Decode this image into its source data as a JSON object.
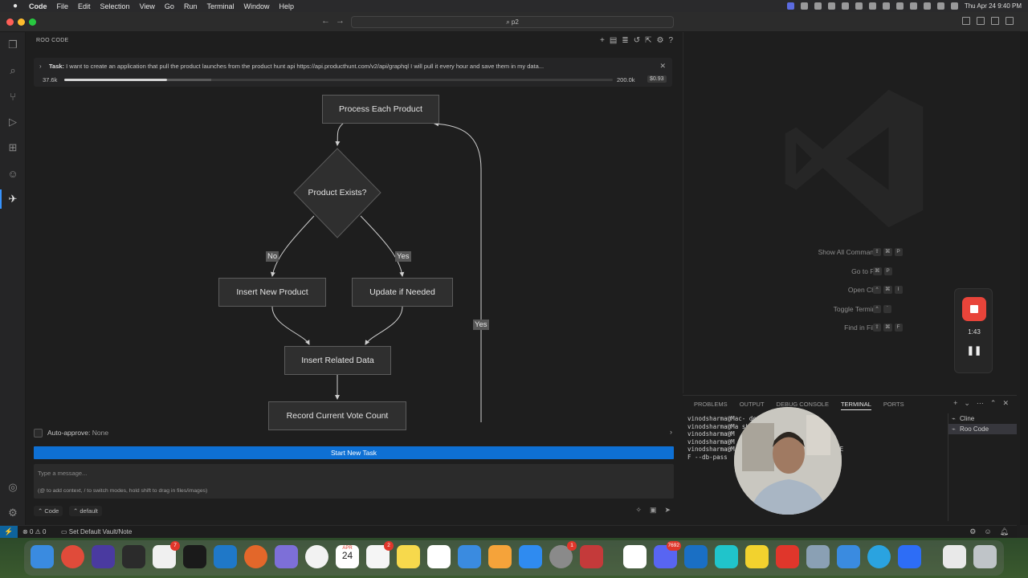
{
  "menubar": {
    "app": "Code",
    "items": [
      "File",
      "Edit",
      "Selection",
      "View",
      "Go",
      "Run",
      "Terminal",
      "Window",
      "Help"
    ],
    "clock": "Thu Apr 24  9:40 PM"
  },
  "titlebar": {
    "search": "p2"
  },
  "roo": {
    "header": "ROO CODE",
    "task_label": "Task:",
    "task_text": "I want to create an application that pull the product launches from the product hunt api https://api.producthunt.com/v2/api/graphql I will pull it every hour and save them in my data...",
    "tokens_used": "37.6k",
    "tokens_max": "200.0k",
    "token_progress": 0.188,
    "cost": "$0.93"
  },
  "flow": {
    "process": "Process Each Product",
    "decision": "Product Exists?",
    "insert_new": "Insert New Product",
    "update": "Update if Needed",
    "insert_related": "Insert Related Data",
    "record_vote": "Record Current Vote Count",
    "label_no": "No",
    "label_yes": "Yes",
    "label_loop_yes": "Yes"
  },
  "composer": {
    "auto_approve_label": "Auto-approve:",
    "auto_approve_value": "None",
    "new_task": "Start New Task",
    "placeholder": "Type a message...",
    "hint": "(@ to add context, / to switch modes, hold shift to drag in files/images)",
    "mode": "Code",
    "profile": "default"
  },
  "editor": {
    "shortcuts": [
      {
        "label": "Show All Commands",
        "keys": [
          "⇧",
          "⌘",
          "P"
        ]
      },
      {
        "label": "Go to File",
        "keys": [
          "⌘",
          "P"
        ]
      },
      {
        "label": "Open Chat",
        "keys": [
          "^",
          "⌘",
          "I"
        ]
      },
      {
        "label": "Toggle Terminal",
        "keys": [
          "^",
          "`"
        ]
      },
      {
        "label": "Find in Files",
        "keys": [
          "⇧",
          "⌘",
          "F"
        ]
      }
    ]
  },
  "recorder": {
    "time": "1:43",
    "pause": "❚❚"
  },
  "panel": {
    "tabs": [
      "PROBLEMS",
      "OUTPUT",
      "DEBUG CONSOLE",
      "TERMINAL",
      "PORTS"
    ],
    "active_tab": "TERMINAL",
    "lines": [
      "vinodsharma@Mac-                  deploy.sh",
      "vinodsharma@Ma                  sh --projec",
      "vinodsharma@M",
      "vinodsharma@M",
      "vinodsharma@M                  --project-ref YOUR_PROJECT_RE",
      "F --db-pass"
    ],
    "terminals": [
      "Cline",
      "Roo Code"
    ]
  },
  "statusbar": {
    "errors": "0",
    "warnings": "0",
    "vault": "Set Default Vault/Note"
  },
  "dock": {
    "calendar_month": "APR",
    "calendar_day": "24",
    "badges": {
      "todoist": "7",
      "reminders": "2",
      "system": "1",
      "discord": "7692"
    }
  },
  "colors": {
    "accent_button": "#0e70d4",
    "record_red": "#e8443a",
    "node_fill": "#2f2f2f",
    "node_border": "#5c5c5c"
  }
}
